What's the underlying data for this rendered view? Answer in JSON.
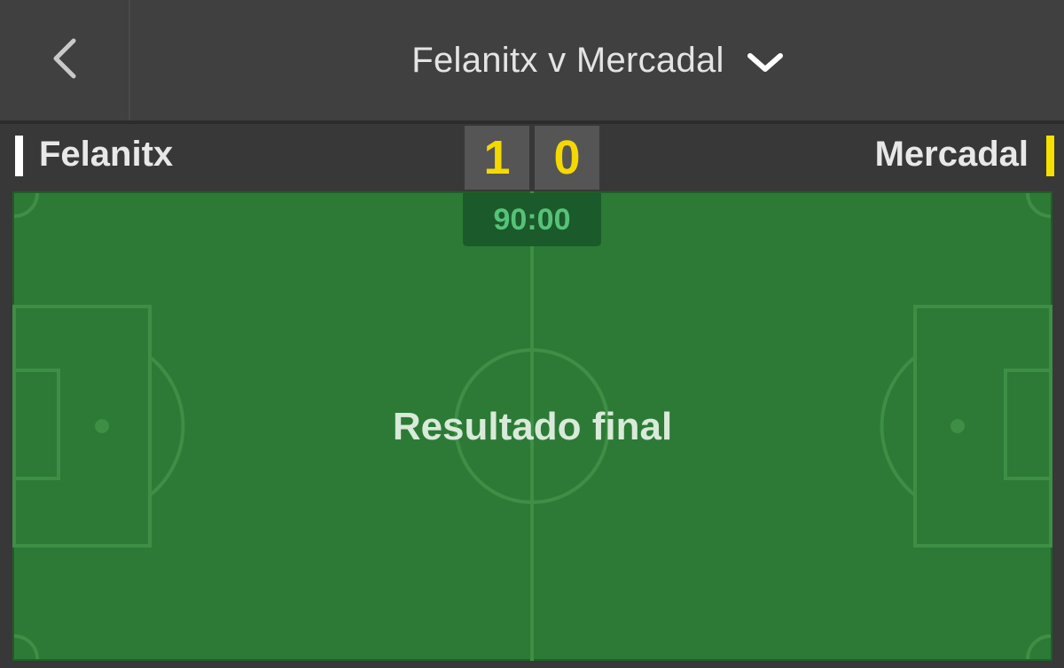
{
  "header": {
    "back_icon": "chevron-left-icon",
    "match_title": "Felanitx v Mercadal",
    "dropdown_icon": "chevron-down-icon"
  },
  "scoreboard": {
    "home": {
      "name": "Felanitx",
      "color": "#ffffff",
      "score": "1"
    },
    "away": {
      "name": "Mercadal",
      "color": "#f5e000",
      "score": "0"
    },
    "score_color": "#f5d800"
  },
  "pitch": {
    "clock": "90:00",
    "status": "Resultado final",
    "grass_color": "#2c7a36",
    "line_color": "#3f8e45"
  }
}
